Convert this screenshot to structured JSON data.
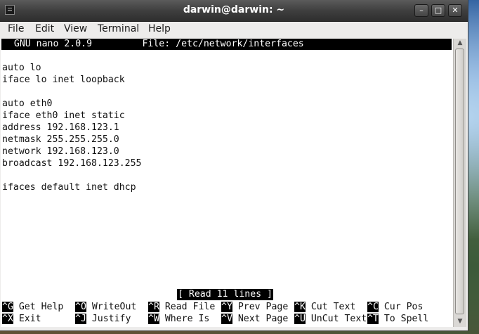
{
  "window": {
    "title": "darwin@darwin: ~",
    "min_symbol": "–",
    "max_symbol": "□",
    "close_symbol": "✕"
  },
  "menu": {
    "items": [
      "File",
      "Edit",
      "View",
      "Terminal",
      "Help"
    ]
  },
  "nano": {
    "header": "  GNU nano 2.0.9         File: /etc/network/interfaces",
    "lines": [
      "",
      "auto lo",
      "iface lo inet loopback",
      "",
      "auto eth0",
      "iface eth0 inet static",
      "address 192.168.123.1",
      "netmask 255.255.255.0",
      "network 192.168.123.0",
      "broadcast 192.168.123.255",
      "",
      "ifaces default inet dhcp"
    ],
    "status": "[ Read 11 lines ]",
    "shortcuts_row1": [
      {
        "key": "^G",
        "label": "Get Help"
      },
      {
        "key": "^O",
        "label": "WriteOut"
      },
      {
        "key": "^R",
        "label": "Read File"
      },
      {
        "key": "^Y",
        "label": "Prev Page"
      },
      {
        "key": "^K",
        "label": "Cut Text"
      },
      {
        "key": "^C",
        "label": "Cur Pos"
      }
    ],
    "shortcuts_row2": [
      {
        "key": "^X",
        "label": "Exit"
      },
      {
        "key": "^J",
        "label": "Justify"
      },
      {
        "key": "^W",
        "label": "Where Is"
      },
      {
        "key": "^V",
        "label": "Next Page"
      },
      {
        "key": "^U",
        "label": "UnCut Text"
      },
      {
        "key": "^T",
        "label": "To Spell"
      }
    ]
  },
  "scrollbar": {
    "up_arrow": "▲",
    "down_arrow": "▼"
  }
}
